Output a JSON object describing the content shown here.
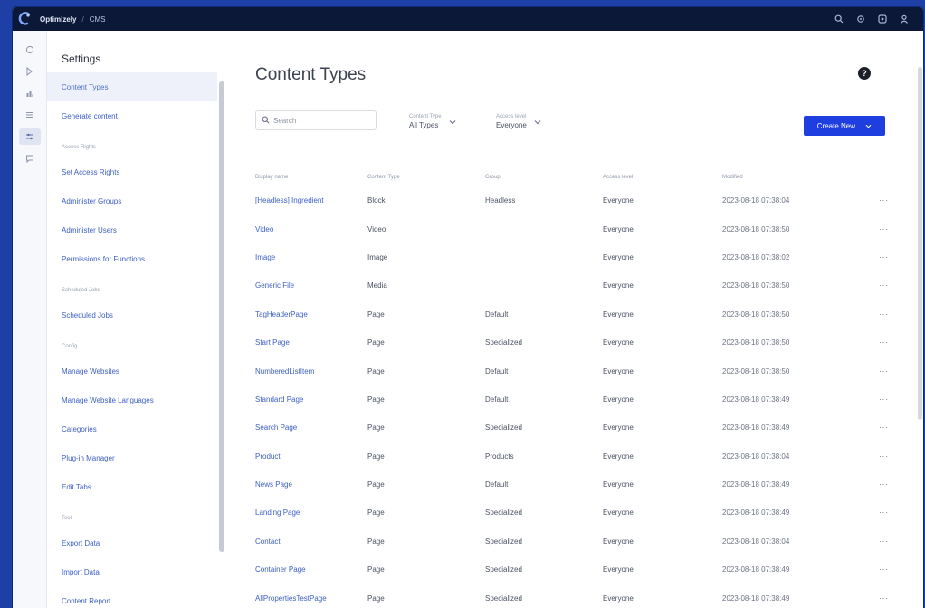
{
  "app": {
    "brand_name": "Optimizely",
    "brand_separator": "/",
    "app_name": "CMS"
  },
  "nav": {
    "title": "Settings",
    "sections": [
      {
        "header": "",
        "items": [
          "Content Types",
          "Generate content"
        ]
      },
      {
        "header": "Access Rights",
        "items": [
          "Set Access Rights",
          "Administer Groups",
          "Administer Users",
          "Permissions for Functions"
        ]
      },
      {
        "header": "Scheduled Jobs",
        "items": [
          "Scheduled Jobs"
        ]
      },
      {
        "header": "Config",
        "items": [
          "Manage Websites",
          "Manage Website Languages",
          "Categories",
          "Plug-in Manager",
          "Edit Tabs"
        ]
      },
      {
        "header": "Tool",
        "items": [
          "Export Data",
          "Import Data",
          "Content Report"
        ]
      }
    ]
  },
  "main": {
    "title": "Content Types",
    "help_label": "?",
    "search": {
      "placeholder": "Search",
      "value": ""
    },
    "filters": [
      {
        "label": "Content Type",
        "value": "All Types"
      },
      {
        "label": "Access level",
        "value": "Everyone"
      }
    ],
    "create_label": "Create New..."
  },
  "table": {
    "headers": [
      "Display name",
      "Content Type",
      "Group",
      "Access level",
      "Modified"
    ],
    "rows": [
      [
        "[Headless] Ingredient",
        "Block",
        "Headless",
        "Everyone",
        "2023-08-18 07:38:04"
      ],
      [
        "Video",
        "Video",
        "",
        "Everyone",
        "2023-08-18 07:38:50"
      ],
      [
        "Image",
        "Image",
        "",
        "Everyone",
        "2023-08-18 07:38:02"
      ],
      [
        "Generic File",
        "Media",
        "",
        "Everyone",
        "2023-08-18 07:38:50"
      ],
      [
        "TagHeaderPage",
        "Page",
        "Default",
        "Everyone",
        "2023-08-18 07:38:50"
      ],
      [
        "Start Page",
        "Page",
        "Specialized",
        "Everyone",
        "2023-08-18 07:38:50"
      ],
      [
        "NumberedListItem",
        "Page",
        "Default",
        "Everyone",
        "2023-08-18 07:38:50"
      ],
      [
        "Standard Page",
        "Page",
        "Default",
        "Everyone",
        "2023-08-18 07:38:49"
      ],
      [
        "Search Page",
        "Page",
        "Specialized",
        "Everyone",
        "2023-08-18 07:38:49"
      ],
      [
        "Product",
        "Page",
        "Products",
        "Everyone",
        "2023-08-18 07:38:04"
      ],
      [
        "News Page",
        "Page",
        "Default",
        "Everyone",
        "2023-08-18 07:38:49"
      ],
      [
        "Landing Page",
        "Page",
        "Specialized",
        "Everyone",
        "2023-08-18 07:38:49"
      ],
      [
        "Contact",
        "Page",
        "Specialized",
        "Everyone",
        "2023-08-18 07:38:04"
      ],
      [
        "Container Page",
        "Page",
        "Specialized",
        "Everyone",
        "2023-08-18 07:38:49"
      ],
      [
        "AllPropertiesTestPage",
        "Page",
        "Specialized",
        "Everyone",
        "2023-08-18 07:38:49"
      ]
    ],
    "row_action_label": "···"
  },
  "colors": {
    "topbar": "#0b1838",
    "accent": "#1f3ee0",
    "link": "#3c5fc4",
    "outer_background": "#1d3fa6"
  },
  "icons": {
    "topbar": [
      "search-icon",
      "settings-icon",
      "help-icon",
      "user-icon"
    ],
    "rail": [
      "dashboard-icon",
      "edit-icon",
      "reports-icon",
      "visitor-groups-icon",
      "settings-icon",
      "chat-icon"
    ]
  }
}
